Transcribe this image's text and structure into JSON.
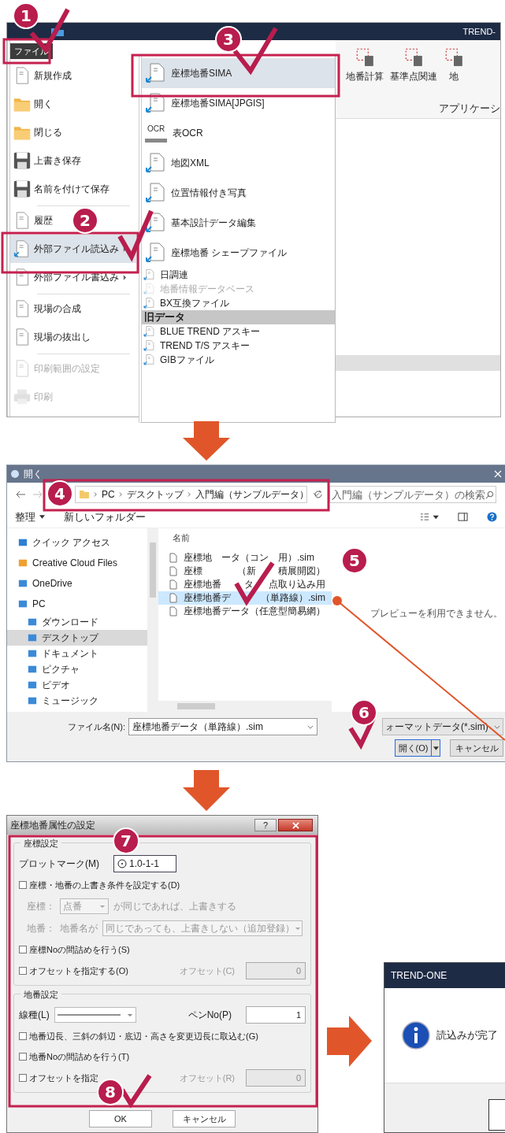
{
  "steps": [
    "1",
    "2",
    "3",
    "4",
    "5",
    "6",
    "7",
    "8"
  ],
  "app": {
    "title": "TREND-",
    "file_tab": {
      "label": "ファイル",
      "selected": true
    },
    "menu": [
      {
        "items": [
          {
            "label": "新規作成",
            "selected": false,
            "disabled": false,
            "submenu": false
          },
          {
            "label": "開く",
            "selected": false,
            "disabled": false,
            "submenu": false
          },
          {
            "label": "閉じる",
            "selected": false,
            "disabled": false,
            "submenu": false
          },
          {
            "label": "上書き保存",
            "selected": false,
            "disabled": false,
            "submenu": false
          },
          {
            "label": "名前を付けて保存",
            "selected": false,
            "disabled": false,
            "submenu": false
          }
        ]
      },
      {
        "items": [
          {
            "label": "履歴",
            "selected": false,
            "disabled": false,
            "submenu": false
          },
          {
            "label": "外部ファイル読込み",
            "selected": true,
            "disabled": false,
            "submenu": true
          },
          {
            "label": "外部ファイル書込み",
            "selected": false,
            "disabled": false,
            "submenu": true
          }
        ]
      },
      {
        "items": [
          {
            "label": "現場の合成",
            "selected": false,
            "disabled": false,
            "submenu": false
          },
          {
            "label": "現場の抜出し",
            "selected": false,
            "disabled": false,
            "submenu": false
          }
        ]
      },
      {
        "items": [
          {
            "label": "印刷範囲の設定",
            "selected": false,
            "disabled": true,
            "submenu": false
          },
          {
            "label": "印刷",
            "selected": false,
            "disabled": true,
            "submenu": false
          }
        ]
      }
    ],
    "submenu": [
      {
        "kind": "large",
        "label": "座標地番SIMA",
        "selected": true,
        "disabled": false
      },
      {
        "kind": "large",
        "label": "座標地番SIMA[JPGIS]",
        "selected": false,
        "disabled": false
      },
      {
        "kind": "large",
        "label": "表OCR",
        "icon_label": "OCR",
        "selected": false,
        "disabled": false
      },
      {
        "kind": "large",
        "label": "地図XML",
        "selected": false,
        "disabled": false
      },
      {
        "kind": "large",
        "label": "位置情報付き写真",
        "selected": false,
        "disabled": false
      },
      {
        "kind": "large",
        "label": "基本設計データ編集",
        "selected": false,
        "disabled": false
      },
      {
        "kind": "large",
        "label": "座標地番 シェープファイル",
        "selected": false,
        "disabled": false
      },
      {
        "kind": "small",
        "label": "日調連",
        "selected": false,
        "disabled": false
      },
      {
        "kind": "small",
        "label": "地番情報データベース",
        "selected": false,
        "disabled": true
      },
      {
        "kind": "small",
        "label": "BX互換ファイル",
        "selected": false,
        "disabled": false
      },
      {
        "kind": "header",
        "label": "旧データ"
      },
      {
        "kind": "small",
        "label": "BLUE TREND アスキー",
        "selected": false,
        "disabled": false
      },
      {
        "kind": "small",
        "label": "TREND T/S アスキー",
        "selected": false,
        "disabled": false
      },
      {
        "kind": "small",
        "label": "GIBファイル",
        "selected": false,
        "disabled": false
      }
    ],
    "ribbon": {
      "buttons": [
        "地番計算",
        "基準点関連",
        "地"
      ],
      "group_label": "アプリケーシ"
    }
  },
  "open_dialog": {
    "title": "開く",
    "path": [
      "PC",
      "デスクトップ",
      "入門編（サンプルデータ）"
    ],
    "search_placeholder": "入門編（サンプルデータ）の検索",
    "toolbar": [
      "整理",
      "新しいフォルダー"
    ],
    "nav": [
      {
        "label": "クイック アクセス",
        "selected": false
      },
      {
        "label": "Creative Cloud Files",
        "selected": false
      },
      {
        "label": "OneDrive",
        "selected": false
      },
      {
        "label": "PC",
        "selected": false,
        "children": [
          {
            "label": "ダウンロード",
            "selected": false
          },
          {
            "label": "デスクトップ",
            "selected": true
          },
          {
            "label": "ドキュメント",
            "selected": false
          },
          {
            "label": "ピクチャ",
            "selected": false
          },
          {
            "label": "ビデオ",
            "selected": false
          },
          {
            "label": "ミュージック",
            "selected": false
          }
        ]
      }
    ],
    "column_header": "名前",
    "files": [
      {
        "parts": [
          "座標地",
          "ータ（コン",
          "用）.sim"
        ],
        "selected": false
      },
      {
        "parts": [
          "座標",
          "（新",
          "積展開図）"
        ],
        "selected": false
      },
      {
        "parts": [
          "座標地番",
          "タ",
          "点取り込み用"
        ],
        "selected": false
      },
      {
        "parts": [
          "座標地番デ",
          "（単路線）.sim"
        ],
        "selected": true
      },
      {
        "parts": [
          "座標地番データ（任意型簡易網）"
        ],
        "selected": false
      }
    ],
    "preview_text": "プレビューを利用できません。",
    "file_name_label": "ファイル名(N):",
    "file_name": "座標地番データ（単路線）.sim",
    "file_type": "ォーマットデータ(*.sim)",
    "open_button": "開く(O)",
    "cancel_button": "キャンセル"
  },
  "props_dialog": {
    "title": "座標地番属性の設定",
    "help": "?",
    "coord_group": {
      "title": "座標設定",
      "plot_mark_label": "プロットマーク(M)",
      "plot_mark_value": "1.0-1-1",
      "overwrite": {
        "label": "座標・地番の上書き条件を設定する(D)",
        "checked": false
      },
      "conditions_disabled": true,
      "coord_label": "座標：",
      "coord_combo": "点番",
      "coord_suffix": "が同じであれば、上書きする",
      "lot_label": "地番：",
      "lot_name_label": "地番名が",
      "lot_combo": "同じであっても、上書きしない（追加登録）",
      "renumber": {
        "label": "座標Noの間詰めを行う(S)",
        "checked": false
      },
      "offset": {
        "label": "オフセットを指定する(O)",
        "checked": false
      },
      "offset_field_label": "オフセット(C)",
      "offset_value": "0"
    },
    "lot_group": {
      "title": "地番設定",
      "line_type_label": "線種(L)",
      "pen_label": "ペンNo(P)",
      "pen_value": "1",
      "checks": [
        {
          "label": "地番辺長、三斜の斜辺・底辺・高さを変更辺長に取込む(G)",
          "checked": false
        },
        {
          "label": "地番Noの間詰めを行う(T)",
          "checked": false
        },
        {
          "label": "オフセットを指定",
          "checked": false
        }
      ],
      "offset_field_label": "オフセット(R)",
      "offset_value": "0"
    },
    "buttons": [
      "OK",
      "キャンセル"
    ]
  },
  "message": {
    "title": "TREND-ONE",
    "text": "読込みが完了"
  }
}
